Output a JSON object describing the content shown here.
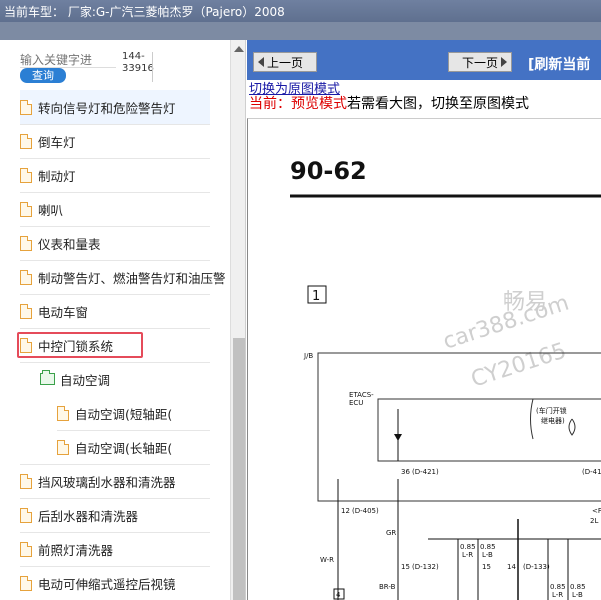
{
  "window": {
    "title": "当前车型：  厂家:G-广汽三菱帕杰罗（Pajero）2008"
  },
  "search": {
    "placeholder": "输入关键字进",
    "button_label": "查询",
    "count_top": "144-",
    "count_bottom": "33916"
  },
  "tree": {
    "items": [
      {
        "label": "转向信号灯和危险警告灯",
        "kind": "doc"
      },
      {
        "label": "倒车灯",
        "kind": "doc"
      },
      {
        "label": "制动灯",
        "kind": "doc"
      },
      {
        "label": "喇叭",
        "kind": "doc"
      },
      {
        "label": "仪表和量表",
        "kind": "doc"
      },
      {
        "label": "制动警告灯、燃油警告灯和油压警",
        "kind": "doc"
      },
      {
        "label": "电动车窗",
        "kind": "doc"
      },
      {
        "label": "中控门锁系统",
        "kind": "doc"
      },
      {
        "label": "自动空调",
        "kind": "folder"
      },
      {
        "label": "自动空调(短轴距(",
        "kind": "doc"
      },
      {
        "label": "自动空调(长轴距(",
        "kind": "doc"
      },
      {
        "label": "挡风玻璃刮水器和清洗器",
        "kind": "doc"
      },
      {
        "label": "后刮水器和清洗器",
        "kind": "doc"
      },
      {
        "label": "前照灯清洗器",
        "kind": "doc"
      },
      {
        "label": "电动可伸缩式遥控后视镜",
        "kind": "doc"
      }
    ]
  },
  "toolbar": {
    "prev_label": "上一页",
    "next_label": "下一页",
    "refresh_label": "[刷新当前"
  },
  "content": {
    "switch_link": "切换为原图模式",
    "mode_prefix": "当前：预览模式",
    "mode_suffix": "若需看大图，切换至原图模式"
  },
  "diagram": {
    "page_number": "90-62",
    "box_label": "1",
    "watermark_1": "畅易",
    "watermark_2": "car388.com",
    "watermark_3": "CY20165",
    "jb_label": "J/B",
    "etacs_label_1": "ETACS-",
    "etacs_label_2": "ECU",
    "unlock_label_1": "(车门开锁",
    "unlock_label_2": "继电器)",
    "pin_36": "36",
    "conn_d421": "(D-421)",
    "conn_d41": "(D-41",
    "pin_12": "12",
    "conn_d405": "(D-405)",
    "wire_gr": "GR",
    "wire_wr": "W-R",
    "pin_15": "15",
    "conn_d132": "(D-132)",
    "wire_brb": "BR-B",
    "wire_085_1": "0.85",
    "wire_lr": "L-R",
    "wire_085_2": "0.85",
    "wire_lb": "L-B",
    "pin_15b": "15",
    "pin_14": "14",
    "conn_d133": "(D-133)",
    "wire_085_3": "0.85",
    "wire_lr_2": "L-R",
    "wire_085_4": "0.85",
    "wire_lb_2": "L-B",
    "label_2l": "2L",
    "label_lt": "<F",
    "box_4": "4"
  }
}
